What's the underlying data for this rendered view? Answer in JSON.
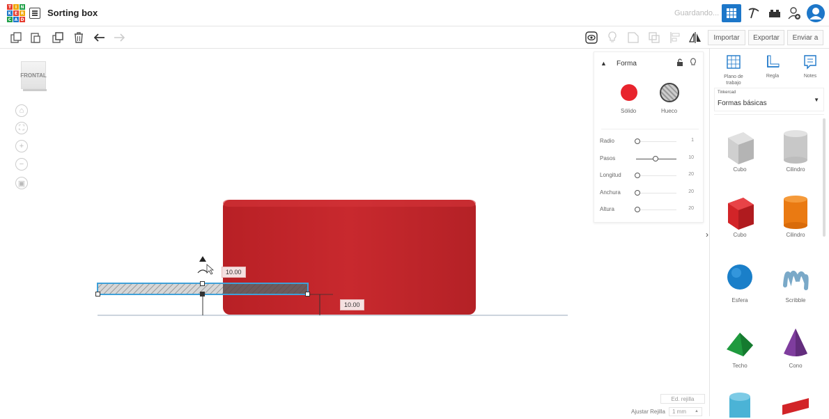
{
  "header": {
    "title": "Sorting box",
    "saving_status": "Guardando...",
    "logo_letters": [
      "T",
      "I",
      "N",
      "K",
      "E",
      "R",
      "C",
      "A",
      "D"
    ]
  },
  "toolbar_right": {
    "import": "Importar",
    "export": "Exportar",
    "send": "Enviar a"
  },
  "viewcube_label": "FRONTAL",
  "shape_panel": {
    "title": "Forma",
    "solid": "Sólido",
    "hole": "Hueco",
    "params": [
      {
        "label": "Radio",
        "value": "1",
        "level": 0.0
      },
      {
        "label": "Pasos",
        "value": "10",
        "level": 0.45
      },
      {
        "label": "Longitud",
        "value": "20",
        "level": 0.0
      },
      {
        "label": "Anchura",
        "value": "20",
        "level": 0.0
      },
      {
        "label": "Altura",
        "value": "20",
        "level": 0.0
      }
    ]
  },
  "sidebar": {
    "tools": [
      {
        "label": "Plano de trabajo",
        "icon": "workplane-icon"
      },
      {
        "label": "Regla",
        "icon": "ruler-icon"
      },
      {
        "label": "Notes",
        "icon": "note-icon"
      }
    ],
    "source_caption": "Tinkercad",
    "category": "Formas básicas",
    "shapes": [
      "Cubo",
      "Cilindro",
      "Cubo",
      "Cilindro",
      "Esfera",
      "Scribble",
      "Techo",
      "Cono"
    ]
  },
  "dimensions": {
    "top_value": "10.00",
    "right_value": "10.00"
  },
  "grid": {
    "edit_label": "Ed. rejilla",
    "snap_label": "Ajustar Rejilla",
    "snap_value": "1 mm"
  },
  "colors": {
    "brand_blue": "#1d77c9",
    "solid_red": "#e8242d",
    "box_red": "#c1272d",
    "selection_blue": "#3fa0d8"
  }
}
